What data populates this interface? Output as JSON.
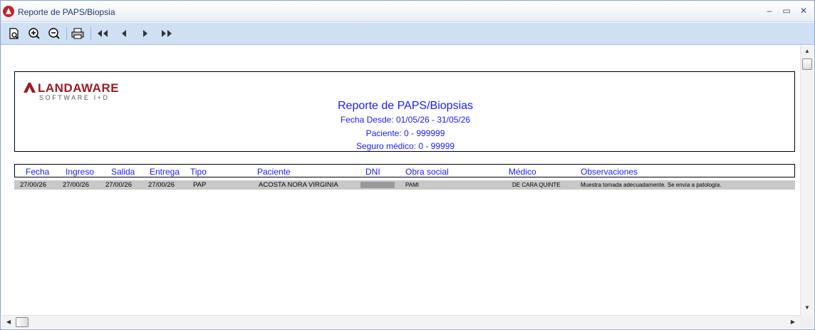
{
  "window": {
    "title": "Reporte de PAPS/Biopsia"
  },
  "toolbar": {
    "buttons": [
      {
        "icon": "page-preview-icon"
      },
      {
        "icon": "zoom-in-icon"
      },
      {
        "icon": "zoom-out-icon"
      },
      {
        "icon": "printer-icon"
      },
      {
        "icon": "first-page-icon"
      },
      {
        "icon": "prev-page-icon"
      },
      {
        "icon": "next-page-icon"
      },
      {
        "icon": "last-page-icon"
      }
    ]
  },
  "logo": {
    "word": "LANDAWARE",
    "sub": "SOFTWARE I+D"
  },
  "report": {
    "title": "Reporte de PAPS/Biopsias",
    "fecha": "Fecha Desde: 01/05/26 - 31/05/26",
    "paciente": "Paciente: 0 - 999999",
    "seguro": "Seguro médico: 0 - 99999",
    "colors": {
      "heading": "#1a1aff",
      "row_bg": "#c8c8c8"
    }
  },
  "table": {
    "headers": [
      "Fecha",
      "Ingreso",
      "Salida",
      "Entrega",
      "Tipo",
      "Paciente",
      "DNI",
      "Obra social",
      "Médico",
      "Observaciones"
    ],
    "rows": [
      {
        "fecha": "27/00/26",
        "ingreso": "27/00/26",
        "salida": "27/00/26",
        "entrega": "27/00/26",
        "tipo": "PAP",
        "paciente": "ACOSTA NORA VIRGINIA",
        "obra_social": "PAMI",
        "medico": "DE CARA QUINTE",
        "observaciones": "Muestra tomada adecuadamente. Se envía a patología."
      }
    ]
  }
}
